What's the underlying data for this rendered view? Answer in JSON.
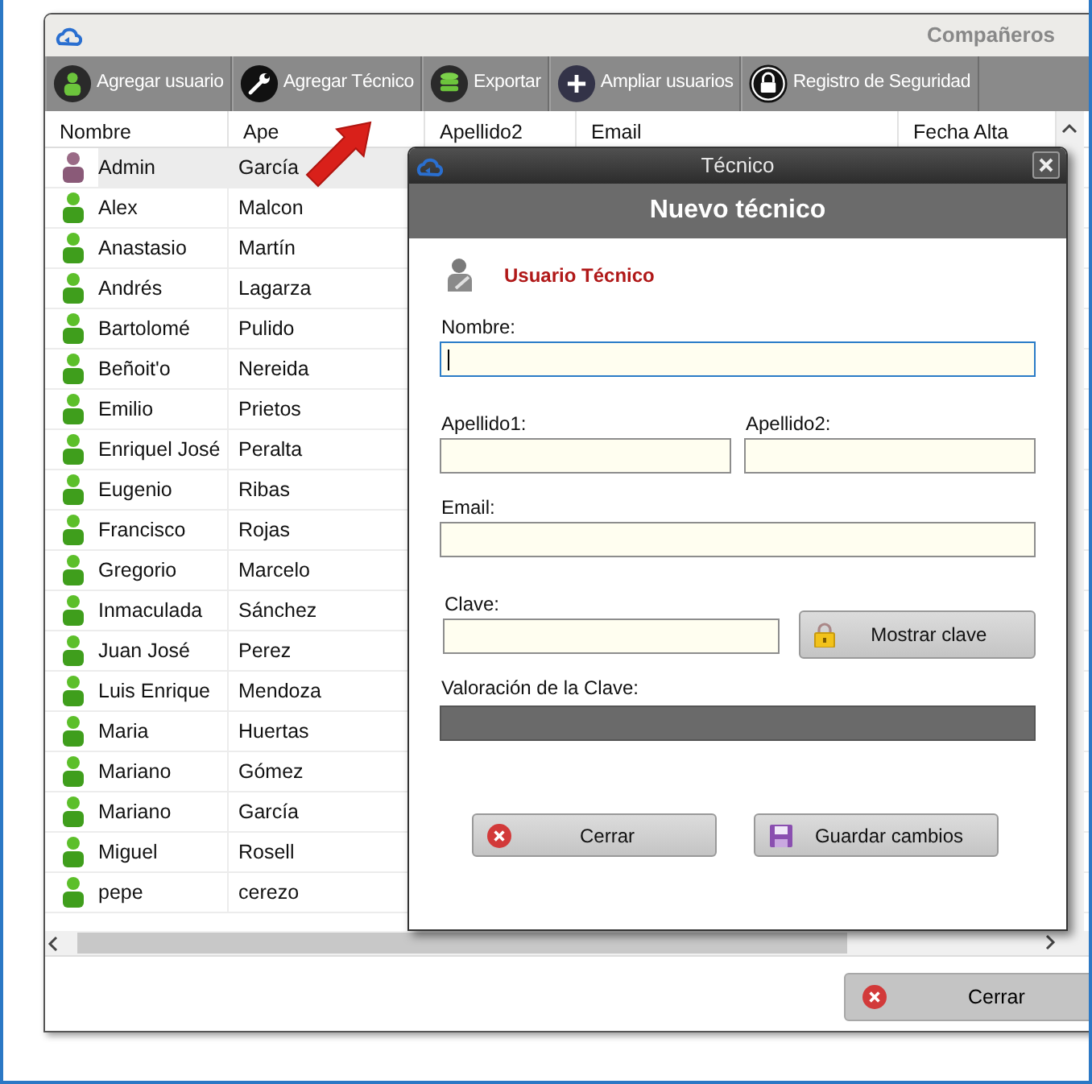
{
  "window": {
    "title": "Compañeros"
  },
  "toolbar": [
    {
      "label": "Agregar usuario"
    },
    {
      "label": "Agregar Técnico"
    },
    {
      "label": "Exportar"
    },
    {
      "label": "Ampliar usuarios"
    },
    {
      "label": "Registro de Seguridad"
    }
  ],
  "table": {
    "columns": [
      "Nombre",
      "Ape",
      "Apellido2",
      "Email",
      "Fecha Alta"
    ],
    "rows": [
      {
        "kind": "admin",
        "selected": true,
        "cells": [
          "Admin",
          "García"
        ]
      },
      {
        "kind": "user",
        "selected": false,
        "cells": [
          "Alex",
          "Malcon"
        ]
      },
      {
        "kind": "user",
        "selected": false,
        "cells": [
          "Anastasio",
          "Martín"
        ]
      },
      {
        "kind": "user",
        "selected": false,
        "cells": [
          "Andrés",
          "Lagarza"
        ]
      },
      {
        "kind": "user",
        "selected": false,
        "cells": [
          "Bartolomé",
          "Pulido"
        ]
      },
      {
        "kind": "user",
        "selected": false,
        "cells": [
          "Beñoit'o",
          "Nereida"
        ]
      },
      {
        "kind": "user",
        "selected": false,
        "cells": [
          "Emilio",
          "Prietos"
        ]
      },
      {
        "kind": "user",
        "selected": false,
        "cells": [
          "Enriquel José",
          "Peralta"
        ]
      },
      {
        "kind": "user",
        "selected": false,
        "cells": [
          "Eugenio",
          "Ribas"
        ]
      },
      {
        "kind": "user",
        "selected": false,
        "cells": [
          "Francisco",
          "Rojas"
        ]
      },
      {
        "kind": "user",
        "selected": false,
        "cells": [
          "Gregorio",
          "Marcelo"
        ]
      },
      {
        "kind": "user",
        "selected": false,
        "cells": [
          "Inmaculada",
          "Sánchez"
        ]
      },
      {
        "kind": "user",
        "selected": false,
        "cells": [
          "Juan José",
          "Perez"
        ]
      },
      {
        "kind": "user",
        "selected": false,
        "cells": [
          "Luis Enrique",
          "Mendoza"
        ]
      },
      {
        "kind": "user",
        "selected": false,
        "cells": [
          "Maria",
          "Huertas"
        ]
      },
      {
        "kind": "user",
        "selected": false,
        "cells": [
          "Mariano",
          "Gómez"
        ]
      },
      {
        "kind": "user",
        "selected": false,
        "cells": [
          "Mariano",
          "García"
        ]
      },
      {
        "kind": "user",
        "selected": false,
        "cells": [
          "Miguel",
          "Rosell"
        ]
      },
      {
        "kind": "user",
        "selected": false,
        "cells": [
          "pepe",
          "cerezo"
        ]
      }
    ]
  },
  "close_button": "Cerrar",
  "dialog": {
    "title": "Técnico",
    "header": "Nuevo técnico",
    "section": "Usuario Técnico",
    "fields": [
      {
        "kind": "full",
        "label": "Nombre:",
        "focused": true
      },
      {
        "kind": "half",
        "label": "Apellido1:",
        "focused": false
      },
      {
        "kind": "half",
        "label": "Apellido2:",
        "focused": false
      },
      {
        "kind": "full",
        "label": "Email:",
        "focused": false
      },
      {
        "kind": "password",
        "label": "Clave:",
        "focused": false,
        "button": "Mostrar clave"
      }
    ],
    "strength": {
      "label": "Valoración de la Clave:",
      "level": 0
    },
    "buttons": [
      {
        "kind": "close",
        "label": "Cerrar"
      },
      {
        "kind": "save",
        "label": "Guardar cambios"
      }
    ]
  }
}
